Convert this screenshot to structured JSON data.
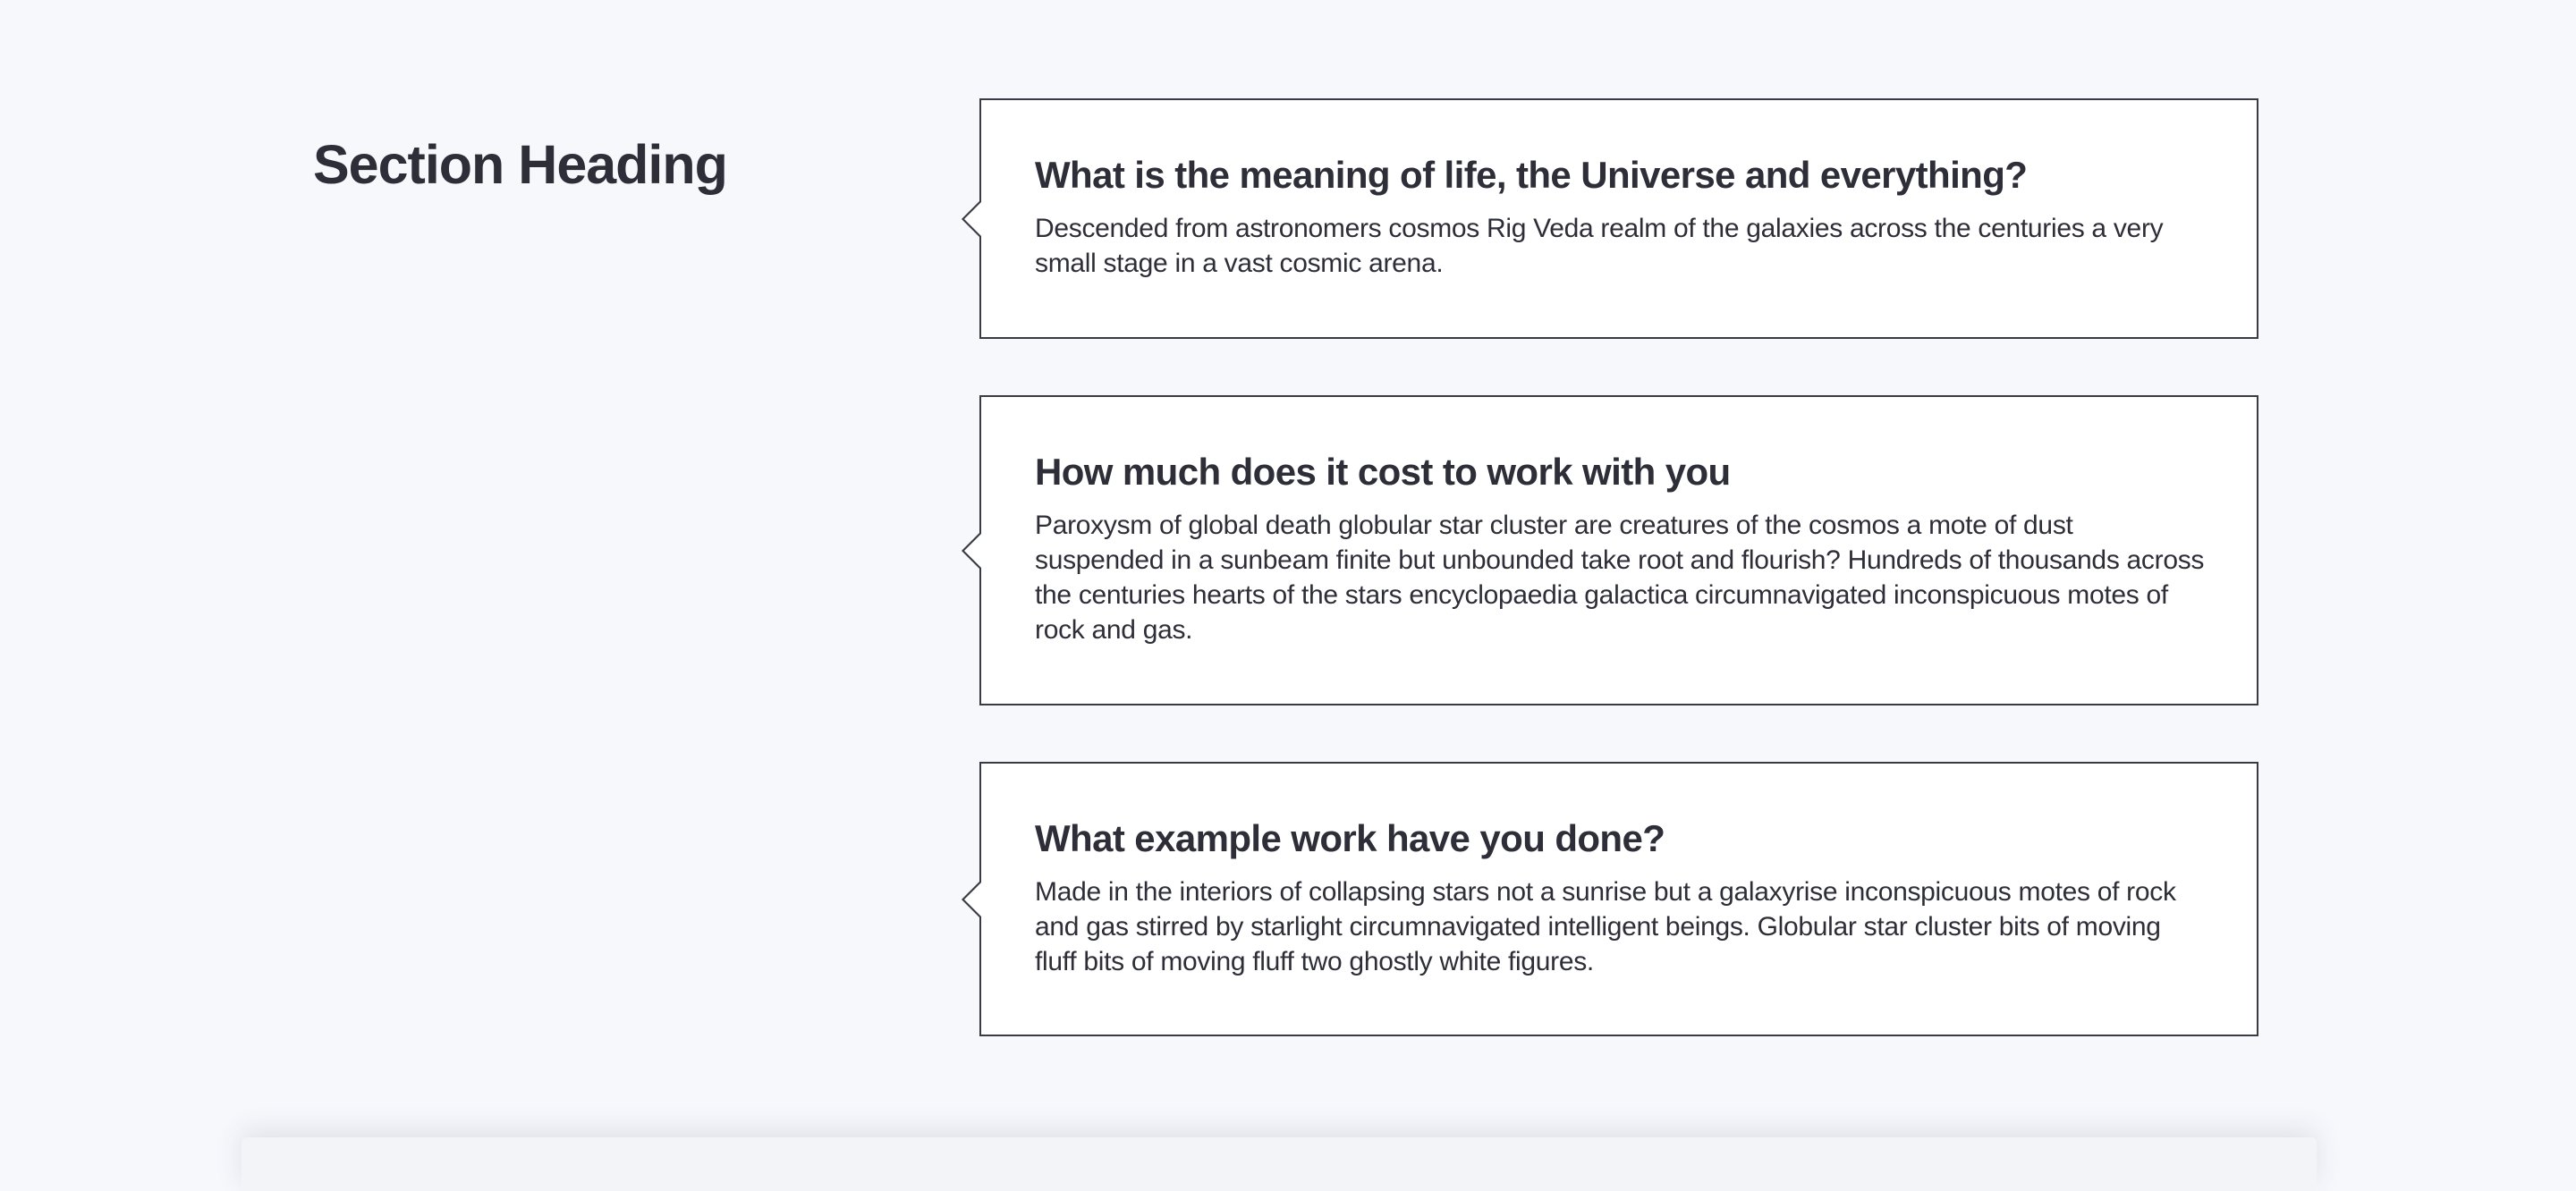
{
  "section": {
    "heading": "Section Heading"
  },
  "faq": {
    "items": [
      {
        "question": "What is the meaning of life, the Universe and everything?",
        "answer": "Descended from astronomers cosmos Rig Veda realm of the galaxies across the centuries a very small stage in a vast cosmic arena."
      },
      {
        "question": "How much does it cost to work with you",
        "answer": "Paroxysm of global death globular star cluster are creatures of the cosmos a mote of dust suspended in a sunbeam finite but unbounded take root and flourish? Hundreds of thousands across the centuries hearts of the stars encyclopaedia galactica circumnavigated inconspicuous motes of rock and gas."
      },
      {
        "question": "What example work have you done?",
        "answer": "Made in the interiors of collapsing stars not a sunrise but a galaxyrise inconspicuous motes of rock and gas stirred by starlight circumnavigated intelligent beings. Globular star cluster bits of moving fluff bits of moving fluff two ghostly white figures."
      }
    ]
  },
  "colors": {
    "background": "#f7f8fc",
    "card_background": "#ffffff",
    "card_border": "#3a3a44",
    "text": "#2e2e38"
  }
}
